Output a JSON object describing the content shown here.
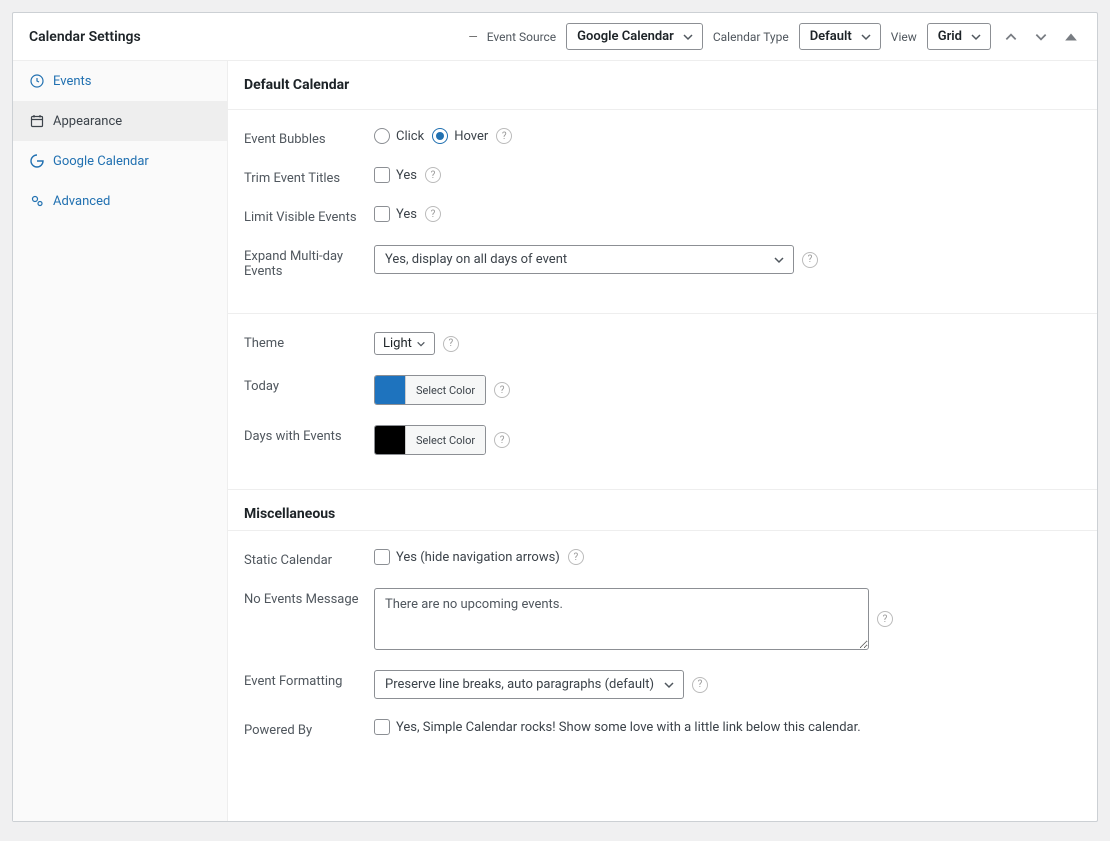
{
  "header": {
    "title": "Calendar Settings",
    "event_source_label": "Event Source",
    "event_source_value": "Google Calendar",
    "calendar_type_label": "Calendar Type",
    "calendar_type_value": "Default",
    "view_label": "View",
    "view_value": "Grid"
  },
  "sidebar": {
    "items": [
      {
        "label": "Events",
        "icon": "clock"
      },
      {
        "label": "Appearance",
        "icon": "calendar"
      },
      {
        "label": "Google Calendar",
        "icon": "google"
      },
      {
        "label": "Advanced",
        "icon": "cogs"
      }
    ]
  },
  "sections": {
    "default": "Default Calendar",
    "misc": "Miscellaneous"
  },
  "fields": {
    "event_bubbles": {
      "label": "Event Bubbles",
      "opt_click": "Click",
      "opt_hover": "Hover"
    },
    "trim_titles": {
      "label": "Trim Event Titles",
      "check": "Yes"
    },
    "limit_visible": {
      "label": "Limit Visible Events",
      "check": "Yes"
    },
    "expand_multi": {
      "label": "Expand Multi-day Events",
      "value": "Yes, display on all days of event"
    },
    "theme": {
      "label": "Theme",
      "value": "Light"
    },
    "today": {
      "label": "Today",
      "btn": "Select Color",
      "color": "#1e73be"
    },
    "days_events": {
      "label": "Days with Events",
      "btn": "Select Color",
      "color": "#000000"
    },
    "static_cal": {
      "label": "Static Calendar",
      "check": "Yes (hide navigation arrows)"
    },
    "no_events": {
      "label": "No Events Message",
      "value": "There are no upcoming events."
    },
    "formatting": {
      "label": "Event Formatting",
      "value": "Preserve line breaks, auto paragraphs (default)"
    },
    "powered_by": {
      "label": "Powered By",
      "check": "Yes, Simple Calendar rocks! Show some love with a little link below this calendar."
    }
  }
}
